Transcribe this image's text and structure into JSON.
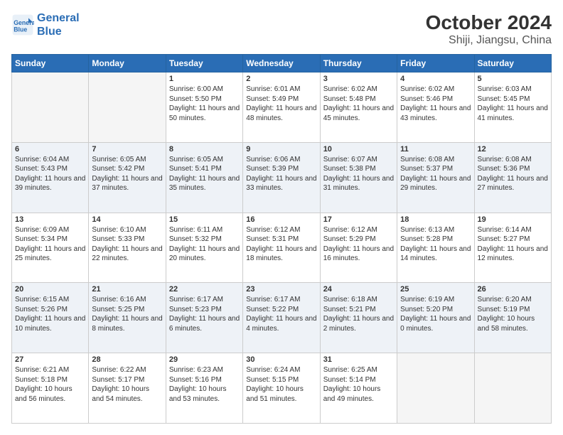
{
  "header": {
    "logo_line1": "General",
    "logo_line2": "Blue",
    "title": "October 2024",
    "subtitle": "Shiji, Jiangsu, China"
  },
  "days_of_week": [
    "Sunday",
    "Monday",
    "Tuesday",
    "Wednesday",
    "Thursday",
    "Friday",
    "Saturday"
  ],
  "weeks": [
    [
      {
        "day": "",
        "info": ""
      },
      {
        "day": "",
        "info": ""
      },
      {
        "day": "1",
        "info": "Sunrise: 6:00 AM\nSunset: 5:50 PM\nDaylight: 11 hours and 50 minutes."
      },
      {
        "day": "2",
        "info": "Sunrise: 6:01 AM\nSunset: 5:49 PM\nDaylight: 11 hours and 48 minutes."
      },
      {
        "day": "3",
        "info": "Sunrise: 6:02 AM\nSunset: 5:48 PM\nDaylight: 11 hours and 45 minutes."
      },
      {
        "day": "4",
        "info": "Sunrise: 6:02 AM\nSunset: 5:46 PM\nDaylight: 11 hours and 43 minutes."
      },
      {
        "day": "5",
        "info": "Sunrise: 6:03 AM\nSunset: 5:45 PM\nDaylight: 11 hours and 41 minutes."
      }
    ],
    [
      {
        "day": "6",
        "info": "Sunrise: 6:04 AM\nSunset: 5:43 PM\nDaylight: 11 hours and 39 minutes."
      },
      {
        "day": "7",
        "info": "Sunrise: 6:05 AM\nSunset: 5:42 PM\nDaylight: 11 hours and 37 minutes."
      },
      {
        "day": "8",
        "info": "Sunrise: 6:05 AM\nSunset: 5:41 PM\nDaylight: 11 hours and 35 minutes."
      },
      {
        "day": "9",
        "info": "Sunrise: 6:06 AM\nSunset: 5:39 PM\nDaylight: 11 hours and 33 minutes."
      },
      {
        "day": "10",
        "info": "Sunrise: 6:07 AM\nSunset: 5:38 PM\nDaylight: 11 hours and 31 minutes."
      },
      {
        "day": "11",
        "info": "Sunrise: 6:08 AM\nSunset: 5:37 PM\nDaylight: 11 hours and 29 minutes."
      },
      {
        "day": "12",
        "info": "Sunrise: 6:08 AM\nSunset: 5:36 PM\nDaylight: 11 hours and 27 minutes."
      }
    ],
    [
      {
        "day": "13",
        "info": "Sunrise: 6:09 AM\nSunset: 5:34 PM\nDaylight: 11 hours and 25 minutes."
      },
      {
        "day": "14",
        "info": "Sunrise: 6:10 AM\nSunset: 5:33 PM\nDaylight: 11 hours and 22 minutes."
      },
      {
        "day": "15",
        "info": "Sunrise: 6:11 AM\nSunset: 5:32 PM\nDaylight: 11 hours and 20 minutes."
      },
      {
        "day": "16",
        "info": "Sunrise: 6:12 AM\nSunset: 5:31 PM\nDaylight: 11 hours and 18 minutes."
      },
      {
        "day": "17",
        "info": "Sunrise: 6:12 AM\nSunset: 5:29 PM\nDaylight: 11 hours and 16 minutes."
      },
      {
        "day": "18",
        "info": "Sunrise: 6:13 AM\nSunset: 5:28 PM\nDaylight: 11 hours and 14 minutes."
      },
      {
        "day": "19",
        "info": "Sunrise: 6:14 AM\nSunset: 5:27 PM\nDaylight: 11 hours and 12 minutes."
      }
    ],
    [
      {
        "day": "20",
        "info": "Sunrise: 6:15 AM\nSunset: 5:26 PM\nDaylight: 11 hours and 10 minutes."
      },
      {
        "day": "21",
        "info": "Sunrise: 6:16 AM\nSunset: 5:25 PM\nDaylight: 11 hours and 8 minutes."
      },
      {
        "day": "22",
        "info": "Sunrise: 6:17 AM\nSunset: 5:23 PM\nDaylight: 11 hours and 6 minutes."
      },
      {
        "day": "23",
        "info": "Sunrise: 6:17 AM\nSunset: 5:22 PM\nDaylight: 11 hours and 4 minutes."
      },
      {
        "day": "24",
        "info": "Sunrise: 6:18 AM\nSunset: 5:21 PM\nDaylight: 11 hours and 2 minutes."
      },
      {
        "day": "25",
        "info": "Sunrise: 6:19 AM\nSunset: 5:20 PM\nDaylight: 11 hours and 0 minutes."
      },
      {
        "day": "26",
        "info": "Sunrise: 6:20 AM\nSunset: 5:19 PM\nDaylight: 10 hours and 58 minutes."
      }
    ],
    [
      {
        "day": "27",
        "info": "Sunrise: 6:21 AM\nSunset: 5:18 PM\nDaylight: 10 hours and 56 minutes."
      },
      {
        "day": "28",
        "info": "Sunrise: 6:22 AM\nSunset: 5:17 PM\nDaylight: 10 hours and 54 minutes."
      },
      {
        "day": "29",
        "info": "Sunrise: 6:23 AM\nSunset: 5:16 PM\nDaylight: 10 hours and 53 minutes."
      },
      {
        "day": "30",
        "info": "Sunrise: 6:24 AM\nSunset: 5:15 PM\nDaylight: 10 hours and 51 minutes."
      },
      {
        "day": "31",
        "info": "Sunrise: 6:25 AM\nSunset: 5:14 PM\nDaylight: 10 hours and 49 minutes."
      },
      {
        "day": "",
        "info": ""
      },
      {
        "day": "",
        "info": ""
      }
    ]
  ]
}
